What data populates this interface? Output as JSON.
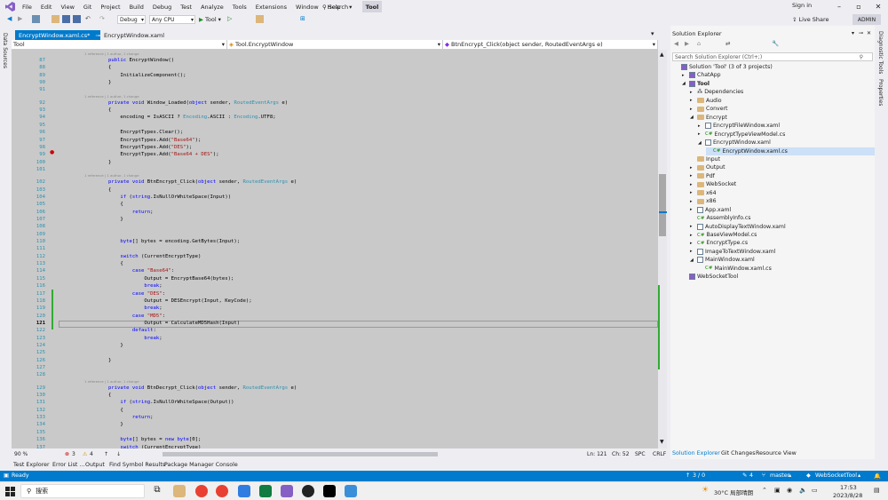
{
  "menu": [
    "File",
    "Edit",
    "View",
    "Git",
    "Project",
    "Build",
    "Debug",
    "Test",
    "Analyze",
    "Tools",
    "Extensions",
    "Window",
    "Help"
  ],
  "search_label": "Search",
  "solution_name": "Tool",
  "sign_in": "Sign in",
  "toolbar": {
    "config": "Debug",
    "platform": "Any CPU",
    "start": "Tool",
    "live_share": "Live Share",
    "admin": "ADMIN"
  },
  "left_strip": "Data Sources",
  "doc_tabs": [
    "EncryptWindow.xaml.cs*",
    "EncryptWindow.xaml"
  ],
  "nav": {
    "project": "Tool",
    "class": "Tool.EncryptWindow",
    "member": "BtnEncrypt_Click(object sender, RoutedEventArgs e)"
  },
  "editor": {
    "lines": [
      {
        "n": "87",
        "t": "        public EncryptWindow()"
      },
      {
        "n": "88",
        "t": "        {"
      },
      {
        "n": "89",
        "t": "            InitializeComponent();"
      },
      {
        "n": "90",
        "t": "        }"
      },
      {
        "n": "91",
        "t": ""
      },
      {
        "n": "92",
        "t": "        private void Window_Loaded(object sender, RoutedEventArgs e)"
      },
      {
        "n": "93",
        "t": "        {"
      },
      {
        "n": "94",
        "t": "            encoding = IsASCII ? Encoding.ASCII : Encoding.UTF8;"
      },
      {
        "n": "95",
        "t": ""
      },
      {
        "n": "96",
        "t": "            EncryptTypes.Clear();"
      },
      {
        "n": "97",
        "t": "            EncryptTypes.Add(\"Base64\");"
      },
      {
        "n": "98",
        "t": "            EncryptTypes.Add(\"DES\");"
      },
      {
        "n": "99",
        "t": "            EncryptTypes.Add(\"Base64 + DES\");"
      },
      {
        "n": "100",
        "t": "        }"
      },
      {
        "n": "101",
        "t": ""
      },
      {
        "n": "102",
        "t": "        private void BtnEncrypt_Click(object sender, RoutedEventArgs e)"
      },
      {
        "n": "103",
        "t": "        {"
      },
      {
        "n": "104",
        "t": "            if (string.IsNullOrWhiteSpace(Input))"
      },
      {
        "n": "105",
        "t": "            {"
      },
      {
        "n": "106",
        "t": "                return;"
      },
      {
        "n": "107",
        "t": "            }"
      },
      {
        "n": "108",
        "t": ""
      },
      {
        "n": "109",
        "t": ""
      },
      {
        "n": "110",
        "t": "            byte[] bytes = encoding.GetBytes(Input);"
      },
      {
        "n": "111",
        "t": ""
      },
      {
        "n": "112",
        "t": "            switch (CurrentEncryptType)"
      },
      {
        "n": "113",
        "t": "            {"
      },
      {
        "n": "114",
        "t": "                case \"Base64\":"
      },
      {
        "n": "115",
        "t": "                    Output = EncryptBase64(bytes);"
      },
      {
        "n": "116",
        "t": "                    break;"
      },
      {
        "n": "117",
        "t": "                case \"DES\":"
      },
      {
        "n": "118",
        "t": "                    Output = DESEncrypt(Input, KeyCode);"
      },
      {
        "n": "119",
        "t": "                    break;"
      },
      {
        "n": "120",
        "t": "                case \"MD5\":"
      },
      {
        "n": "121",
        "t": "                    Output = CalculateMD5Hash(Input)"
      },
      {
        "n": "122",
        "t": "                default:"
      },
      {
        "n": "123",
        "t": "                    break;"
      },
      {
        "n": "124",
        "t": "            }"
      },
      {
        "n": "125",
        "t": ""
      },
      {
        "n": "126",
        "t": "        }"
      },
      {
        "n": "127",
        "t": ""
      },
      {
        "n": "128",
        "t": ""
      },
      {
        "n": "129",
        "t": "        private void BtnDecrypt_Click(object sender, RoutedEventArgs e)"
      },
      {
        "n": "130",
        "t": "        {"
      },
      {
        "n": "131",
        "t": "            if (string.IsNullOrWhiteSpace(Output))"
      },
      {
        "n": "132",
        "t": "            {"
      },
      {
        "n": "133",
        "t": "                return;"
      },
      {
        "n": "134",
        "t": "            }"
      },
      {
        "n": "135",
        "t": ""
      },
      {
        "n": "136",
        "t": "            byte[] bytes = new byte[0];"
      },
      {
        "n": "137",
        "t": "            switch (CurrentEncryptType)"
      }
    ],
    "current_line": "121",
    "lens_text": "1 reference | 1 author, 1 change"
  },
  "status_row": {
    "zoom": "90 %",
    "errors": "3",
    "warnings": "4",
    "ln": "Ln: 121",
    "ch": "Ch: 52",
    "spc": "SPC",
    "crlf": "CRLF"
  },
  "solution_explorer": {
    "title": "Solution Explorer",
    "search_placeholder": "Search Solution Explorer (Ctrl+;)",
    "items": [
      {
        "label": "Solution 'Tool' (3 of 3 projects)",
        "kind": "sln"
      },
      {
        "label": "ChatApp",
        "kind": "proj"
      },
      {
        "label": "Tool",
        "kind": "proj"
      },
      {
        "label": "Dependencies",
        "kind": "dep"
      },
      {
        "label": "Audio",
        "kind": "folder"
      },
      {
        "label": "Convert",
        "kind": "folder"
      },
      {
        "label": "Encrypt",
        "kind": "folder"
      },
      {
        "label": "EncryptFileWindow.xaml",
        "kind": "xaml"
      },
      {
        "label": "EncryptTypeViewModel.cs",
        "kind": "cs"
      },
      {
        "label": "EncryptWindow.xaml",
        "kind": "xaml"
      },
      {
        "label": "EncryptWindow.xaml.cs",
        "kind": "cs"
      },
      {
        "label": "Input",
        "kind": "folder"
      },
      {
        "label": "Output",
        "kind": "folder"
      },
      {
        "label": "Pdf",
        "kind": "folder"
      },
      {
        "label": "WebSocket",
        "kind": "folder"
      },
      {
        "label": "x64",
        "kind": "folder"
      },
      {
        "label": "x86",
        "kind": "folder"
      },
      {
        "label": "App.xaml",
        "kind": "xaml"
      },
      {
        "label": "AssemblyInfo.cs",
        "kind": "cs"
      },
      {
        "label": "AutoDisplayTextWindow.xaml",
        "kind": "xaml"
      },
      {
        "label": "BaseViewModel.cs",
        "kind": "cs"
      },
      {
        "label": "EncryptType.cs",
        "kind": "cs"
      },
      {
        "label": "ImageToTextWindow.xaml",
        "kind": "xaml"
      },
      {
        "label": "MainWindow.xaml",
        "kind": "xaml"
      },
      {
        "label": "MainWindow.xaml.cs",
        "kind": "cs"
      },
      {
        "label": "WebSocketTool",
        "kind": "proj"
      }
    ],
    "tabs": [
      "Solution Explorer",
      "Git Changes",
      "Resource View"
    ]
  },
  "right_strip": [
    "Diagnostic Tools",
    "Properties"
  ],
  "bottom_tabs": [
    "Test Explorer",
    "Error List ...",
    "Output",
    "Find Symbol Results",
    "Package Manager Console"
  ],
  "statusbar": {
    "ready": "Ready",
    "lines": "3 / 0",
    "pencil": "4",
    "branch": "master",
    "repo": "WebSocketTool"
  },
  "taskbar": {
    "search": "搜索",
    "weather": "30°C 局部晴朗",
    "time": "17:53",
    "date": "2023/8/28"
  },
  "colors": {
    "accent": "#007acc",
    "editor_bg": "#c9c9c9"
  }
}
